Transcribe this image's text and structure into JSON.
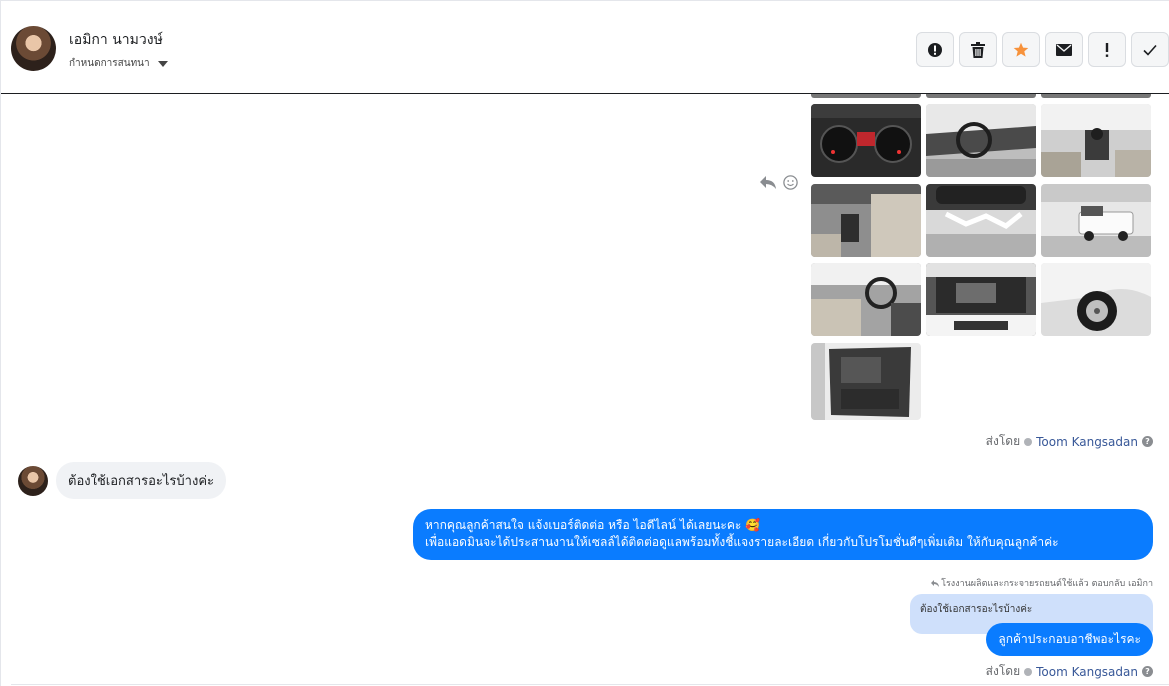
{
  "header": {
    "contact_name": "เอมิกา นามวงษ์",
    "assign_label": "กำหนดการสนทนา"
  },
  "actions": [
    {
      "icon": "alert-circle-icon"
    },
    {
      "icon": "trash-icon"
    },
    {
      "icon": "star-icon",
      "color": "#f7923b"
    },
    {
      "icon": "envelope-icon"
    },
    {
      "icon": "exclamation-icon"
    },
    {
      "icon": "check-icon"
    }
  ],
  "gallery": {
    "photos": [
      {
        "name": "photo-instrument-cluster"
      },
      {
        "name": "photo-dashboard-steering"
      },
      {
        "name": "photo-gear-shift"
      },
      {
        "name": "photo-gear-seat"
      },
      {
        "name": "photo-underbody"
      },
      {
        "name": "photo-white-pickup-exterior"
      },
      {
        "name": "photo-cabin-interior"
      },
      {
        "name": "photo-engine-bay"
      },
      {
        "name": "photo-wheel"
      },
      {
        "name": "photo-door-panel"
      }
    ]
  },
  "sent_by_1": {
    "prefix": "ส่งโดย",
    "name": "Toom Kangsadan"
  },
  "incoming_message": "ต้องใช้เอกสารอะไรบ้างค่ะ",
  "outgoing_message_1": {
    "line1": "หากคุณลูกค้าสนใจ แจ้งเบอร์ติดต่อ หรือ ไอดีไลน์ ได้เลยนะคะ 🥰",
    "line2": "เพื่อแอดมินจะได้ประสานงานให้เซลล์ได้ติดต่อดูแลพร้อมทั้งชี้แจงรายละเอียด เกี่ยวกับโปรโมชั่นดีๆเพิ่มเติม ให้กับคุณลูกค้าค่ะ"
  },
  "reply_note": "โรงงานผลิตและกระจายรถยนต์ใช้แล้ว ตอบกลับ เอมิกา",
  "quoted_message": "ต้องใช้เอกสารอะไรบ้างค่ะ",
  "outgoing_message_2": "ลูกค้าประกอบอาชีพอะไรคะ",
  "sent_by_2": {
    "prefix": "ส่งโดย",
    "name": "Toom Kangsadan"
  }
}
